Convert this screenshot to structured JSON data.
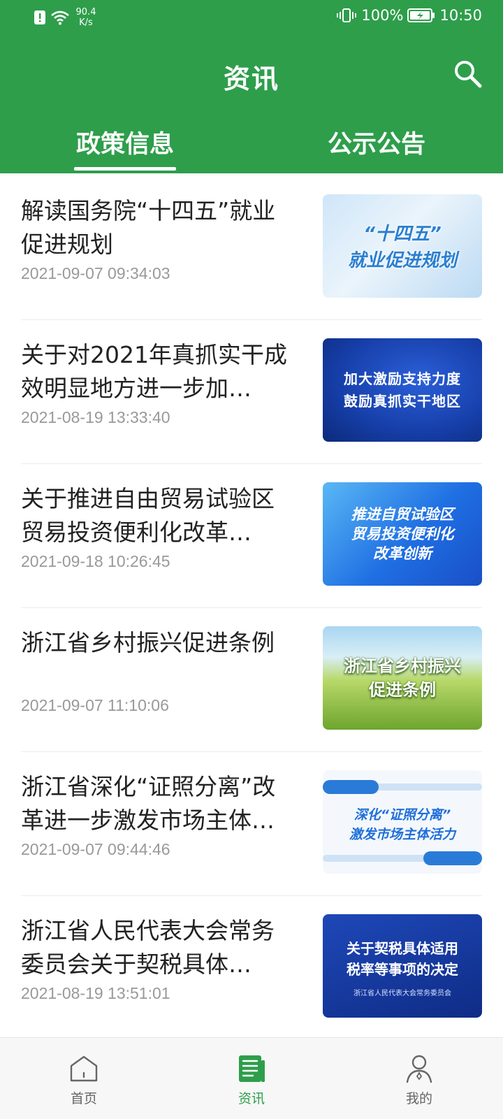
{
  "status_bar": {
    "net_speed_value": "90.4",
    "net_speed_unit": "K/s",
    "battery": "100%",
    "time": "10:50",
    "icons": [
      "alert-icon",
      "wifi-icon",
      "vibrate-icon",
      "battery-charging-icon"
    ]
  },
  "header": {
    "title": "资讯",
    "search_icon": "search-icon",
    "background_color": "#2e9e4b"
  },
  "tabs": [
    {
      "label": "政策信息",
      "active": true
    },
    {
      "label": "公示公告",
      "active": false
    }
  ],
  "articles": [
    {
      "title": "解读国务院“十四五”就业促进规划",
      "date": "2021-09-07 09:34:03",
      "thumb_lines": [
        "“十四五”",
        "就业促进规划"
      ]
    },
    {
      "title": "关于对2021年真抓实干成效明显地方进一步加…",
      "date": "2021-08-19 13:33:40",
      "thumb_lines": [
        "加大激励支持力度",
        "鼓励真抓实干地区"
      ]
    },
    {
      "title": "关于推进自由贸易试验区贸易投资便利化改革…",
      "date": "2021-09-18 10:26:45",
      "thumb_lines": [
        "推进自贸试验区",
        "贸易投资便利化",
        "改革创新"
      ]
    },
    {
      "title": "浙江省乡村振兴促进条例",
      "date": "2021-09-07 11:10:06",
      "thumb_lines": [
        "浙江省乡村振兴",
        "促进条例"
      ]
    },
    {
      "title": "浙江省深化“证照分离”改革进一步激发市场主体…",
      "date": "2021-09-07 09:44:46",
      "thumb_lines": [
        "深化“证照分离”",
        "激发市场主体活力"
      ]
    },
    {
      "title": "浙江省人民代表大会常务委员会关于契税具体…",
      "date": "2021-08-19 13:51:01",
      "thumb_lines": [
        "关于契税具体适用",
        "税率等事项的决定"
      ],
      "thumb_sub": "浙江省人民代表大会常务委员会"
    }
  ],
  "bottom_nav": [
    {
      "label": "首页",
      "icon": "home-icon",
      "active": false
    },
    {
      "label": "资讯",
      "icon": "news-icon",
      "active": true
    },
    {
      "label": "我的",
      "icon": "profile-icon",
      "active": false
    }
  ],
  "colors": {
    "primary": "#2e9e4b",
    "date_text": "#999999",
    "inactive_nav": "#666666"
  }
}
